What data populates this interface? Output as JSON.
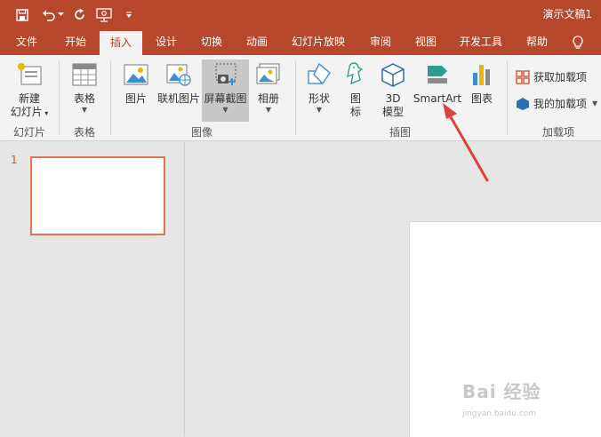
{
  "window": {
    "title": "演示文稿1",
    "accent_color": "#b7472a"
  },
  "qat": {
    "save_icon": "save-icon",
    "undo_icon": "undo-icon",
    "undo_dropdown_icon": "chevron-down-icon",
    "redo_icon": "repeat-icon",
    "present_icon": "present-from-start-icon",
    "customize_icon": "customize-qat-icon"
  },
  "tabs": [
    {
      "label": "文件"
    },
    {
      "label": "开始"
    },
    {
      "label": "插入",
      "active": true
    },
    {
      "label": "设计"
    },
    {
      "label": "切换"
    },
    {
      "label": "动画"
    },
    {
      "label": "幻灯片放映"
    },
    {
      "label": "审阅"
    },
    {
      "label": "视图"
    },
    {
      "label": "开发工具"
    },
    {
      "label": "帮助"
    }
  ],
  "tellme_icon": "lightbulb-icon",
  "ribbon": {
    "groups": [
      {
        "label": "幻灯片"
      },
      {
        "label": "表格"
      },
      {
        "label": "图像"
      },
      {
        "label": "插图"
      },
      {
        "label": "加载项"
      }
    ],
    "new_slide": {
      "line1": "新建",
      "line2": "幻灯片"
    },
    "table": {
      "label": "表格"
    },
    "picture": {
      "label": "图片"
    },
    "online_picture": {
      "label": "联机图片"
    },
    "screenshot": {
      "label": "屏幕截图"
    },
    "album": {
      "label": "相册"
    },
    "shapes": {
      "label": "形状"
    },
    "icons": {
      "line1": "图",
      "line2": "标"
    },
    "model3d": {
      "line1": "3D",
      "line2": "模型"
    },
    "smartart": {
      "label": "SmartArt"
    },
    "chart": {
      "label": "图表"
    },
    "get_addins": {
      "label": "获取加载项"
    },
    "my_addins": {
      "label": "我的加载项"
    }
  },
  "slides_pane": {
    "slide_number": "1"
  },
  "annotation": {
    "arrow_color": "#e0403a"
  },
  "watermark": {
    "line1": "Bai 经验",
    "line2": "jingyan.baidu.com"
  }
}
